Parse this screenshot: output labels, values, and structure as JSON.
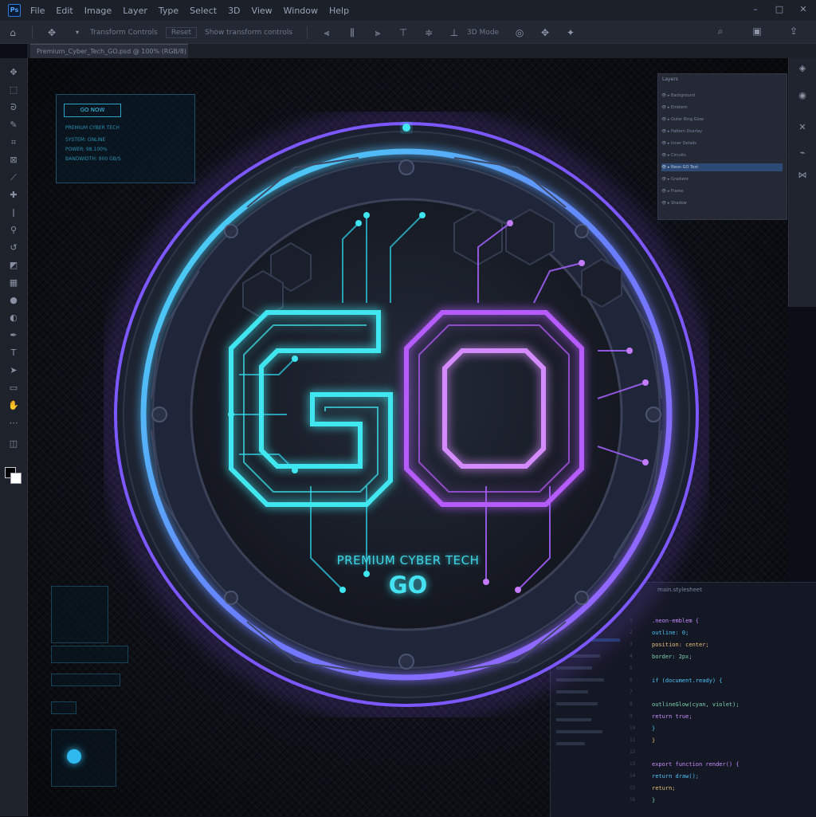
{
  "app": {
    "logo_text": "Ps",
    "menu": [
      "File",
      "Edit",
      "Image",
      "Layer",
      "Type",
      "Select",
      "3D",
      "View",
      "Window",
      "Help"
    ]
  },
  "options_bar": {
    "items": [
      "Transform Controls",
      "Reset",
      "Show transform controls"
    ],
    "extra": "3D Mode"
  },
  "document": {
    "tab_label": "Premium_Cyber_Tech_GO.psd @ 100% (RGB/8)"
  },
  "tools": [
    "move-icon",
    "marquee-icon",
    "lasso-icon",
    "quick-select-icon",
    "crop-icon",
    "frame-icon",
    "eyedropper-icon",
    "healing-icon",
    "brush-icon",
    "stamp-icon",
    "history-brush-icon",
    "eraser-icon",
    "gradient-icon",
    "blur-icon",
    "dodge-icon",
    "pen-icon",
    "type-icon",
    "path-select-icon",
    "shape-icon",
    "hand-icon",
    "zoom-icon"
  ],
  "hud": {
    "badge": "GO NOW",
    "lines": [
      "PREMIUM CYBER TECH",
      "SYSTEM: ONLINE",
      "POWER: 98.100%",
      "BANDWIDTH: 900 GB/S"
    ]
  },
  "layers_panel": {
    "title": "Layers",
    "rows": [
      "Background",
      "Emblem",
      "Outer Ring Glow",
      "Pattern Overlay",
      "Inner Details",
      "Circuits",
      "Neon GO Text",
      "Gradient",
      "Frame",
      "Shadow"
    ],
    "selected_index": 6
  },
  "emblem": {
    "main_text": "GO",
    "tagline": "PREMIUM CYBER TECH",
    "subtitle": "GO",
    "colors": {
      "cyan": "#3fe6f0",
      "violet": "#b65cff",
      "ring_outer": "#8a56ff",
      "body": "#1c2230"
    }
  },
  "code_panel": {
    "tab": "main.stylesheet",
    "lines": [
      ".neon-emblem {",
      "  outline: 0;",
      "  position: center;",
      "  border: 2px;",
      "",
      "  if (document.ready) {",
      "",
      "    outlineGlow(cyan, violet);",
      "    return true;",
      "  }",
      "}",
      "",
      "export function render() {",
      "  return draw();",
      "  return;",
      "}"
    ]
  }
}
